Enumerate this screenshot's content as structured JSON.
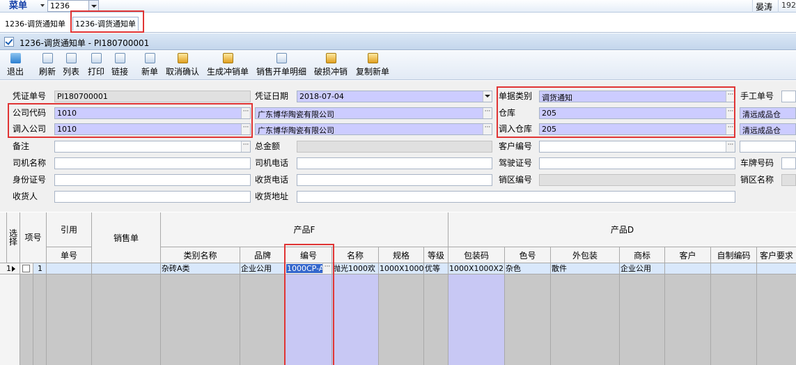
{
  "topbar": {
    "menu_label": "菜单",
    "combo_value": "1236",
    "user_name": "晏涛",
    "ip_text": "192."
  },
  "tabs": [
    {
      "label": "1236-调货通知单"
    },
    {
      "label": "1236-调货通知单"
    }
  ],
  "window": {
    "title": "1236-调货通知单 - PI180700001"
  },
  "toolbar": {
    "exit": "退出",
    "refresh": "刷新",
    "list": "列表",
    "print": "打印",
    "link": "链接",
    "new": "新单",
    "cancel_confirm": "取消确认",
    "gen_offset": "生成冲销单",
    "sales_detail": "销售开单明细",
    "damage_offset": "破损冲销",
    "copy_new": "复制新单"
  },
  "form": {
    "voucher_no_label": "凭证单号",
    "voucher_no": "PI180700001",
    "voucher_date_label": "凭证日期",
    "voucher_date": "2018-07-04",
    "doc_type_label": "单据类别",
    "doc_type": "调货通知",
    "manual_no_label": "手工单号",
    "company_code_label": "公司代码",
    "company_code": "1010",
    "company_name": "广东博华陶瓷有限公司",
    "warehouse_label": "仓库",
    "warehouse": "205",
    "warehouse_name": "清远成品仓",
    "in_company_label": "调入公司",
    "in_company": "1010",
    "in_company_name": "广东博华陶瓷有限公司",
    "in_warehouse_label": "调入仓库",
    "in_warehouse": "205",
    "in_warehouse_name": "清远成品仓",
    "remark_label": "备注",
    "total_label": "总金额",
    "customer_no_label": "客户编号",
    "driver_name_label": "司机名称",
    "driver_phone_label": "司机电话",
    "license_label": "驾驶证号",
    "plate_label": "车牌号码",
    "id_label": "身份证号",
    "receiver_phone_label": "收货电话",
    "sales_area_no_label": "销区编号",
    "sales_area_name_label": "销区名称",
    "receiver_label": "收货人",
    "receiver_addr_label": "收货地址"
  },
  "grid": {
    "headers": {
      "select": "选择",
      "item": "项号",
      "ref": "引用",
      "sales_order": "销售单",
      "ref_no": "单号",
      "product_f": "产品F",
      "product_d": "产品D",
      "category": "类别名称",
      "brand": "品牌",
      "code": "编号",
      "name": "名称",
      "spec": "规格",
      "grade": "等级",
      "pack_code": "包装码",
      "color_no": "色号",
      "outer_pack": "外包装",
      "trademark": "商标",
      "customer": "客户",
      "self_code": "自制编码",
      "customer_req": "客户要求"
    },
    "rows": [
      {
        "row_no": "1",
        "item": "1",
        "category": "杂砖A类",
        "brand": "企业公用",
        "code": "1000CP-A",
        "name": "抛光1000欢",
        "spec": "1000X1000",
        "grade": "优等",
        "pack_code": "1000X1000X2",
        "color_no": "杂色",
        "outer_pack": "散件",
        "trademark": "企业公用"
      }
    ]
  }
}
